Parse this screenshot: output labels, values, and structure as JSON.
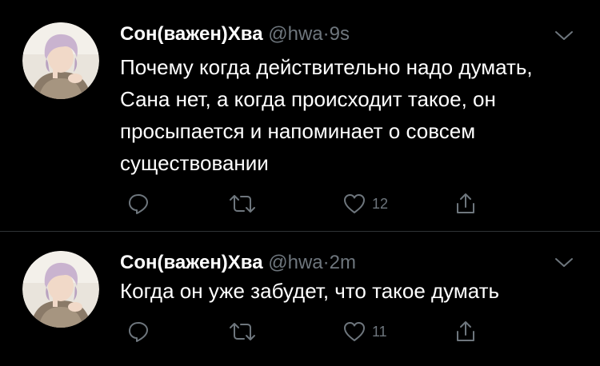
{
  "tweets": [
    {
      "display_name": "Сон(важен)Хва",
      "handle": "@hwa",
      "separator": "·",
      "time": "9s",
      "text": "Почему когда действительно надо думать, Сана нет, а когда происходит такое, он просыпается и напоминает о совсем существовании",
      "like_count": "12"
    },
    {
      "display_name": "Сон(важен)Хва",
      "handle": "@hwa",
      "separator": "·",
      "time": "2m",
      "text": "Когда он уже забудет, что такое думать",
      "like_count": "11"
    }
  ],
  "colors": {
    "background": "#000000",
    "primary_text": "#ffffff",
    "secondary_text": "#6e767d",
    "divider": "#2f3336"
  },
  "icons": [
    "reply-icon",
    "retweet-icon",
    "like-icon",
    "share-icon",
    "chevron-down-icon"
  ]
}
